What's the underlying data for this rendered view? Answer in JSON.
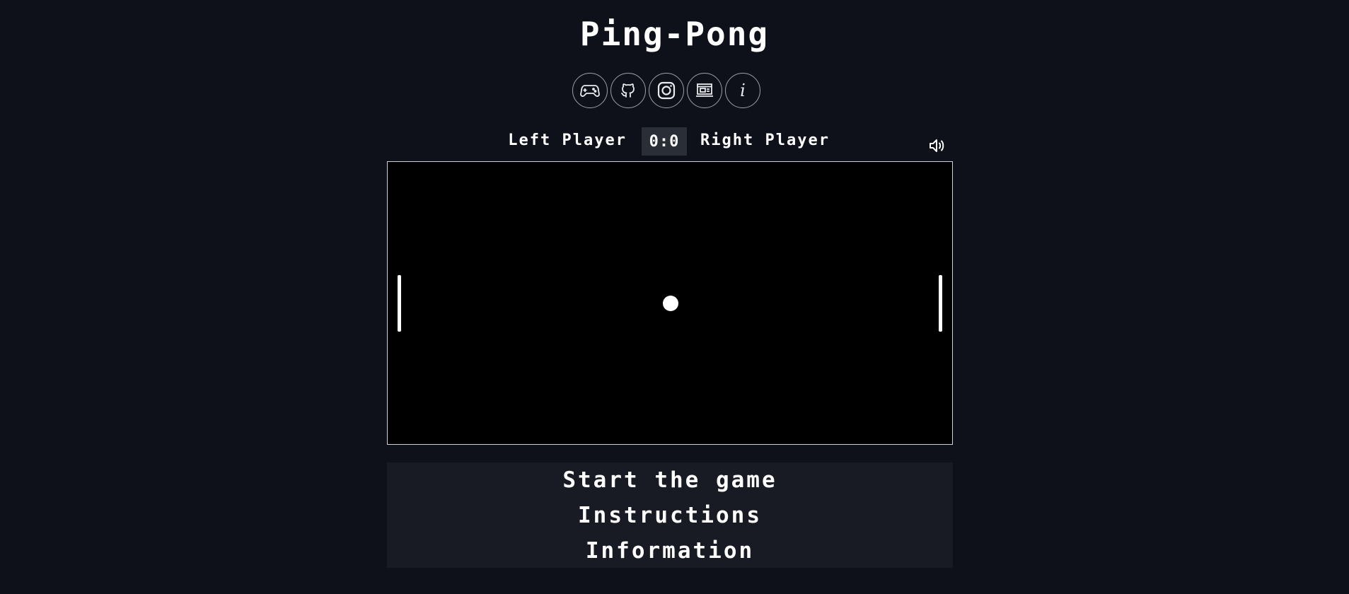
{
  "game": {
    "title": "Ping-Pong"
  },
  "header_icons": [
    {
      "name": "gamepad-icon"
    },
    {
      "name": "github-icon"
    },
    {
      "name": "instagram-icon"
    },
    {
      "name": "portfolio-icon"
    },
    {
      "name": "info-icon",
      "glyph": "i"
    }
  ],
  "scoreboard": {
    "left_player": "Left Player",
    "score": "0:0",
    "right_player": "Right Player",
    "sound_icon": "speaker-icon"
  },
  "menu": {
    "start": "Start the game",
    "instructions": "Instructions",
    "information": "Information"
  },
  "colors": {
    "background": "#0e111a",
    "board": "#000000",
    "menu_background": "#181b23",
    "score_box": "#2a2e37",
    "foreground": "#ffffff"
  }
}
